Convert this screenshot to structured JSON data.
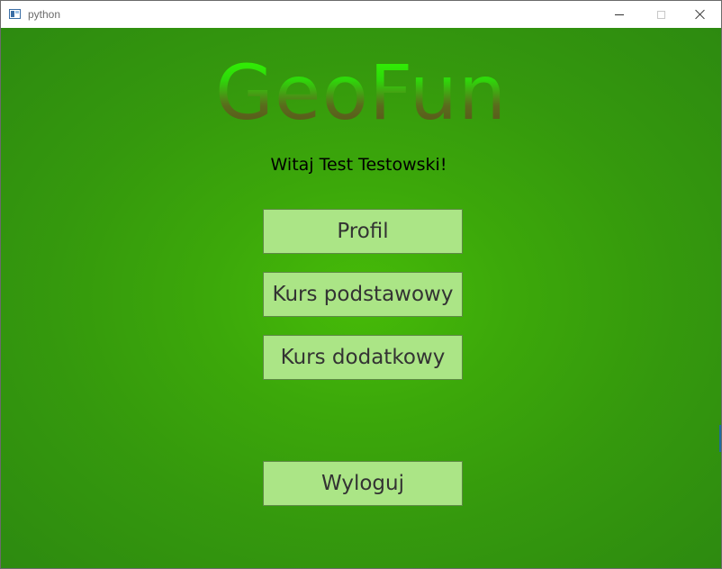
{
  "window": {
    "title": "python",
    "controls": {
      "minimize": "minimize-icon",
      "maximize": "maximize-icon",
      "close": "close-icon"
    }
  },
  "app": {
    "logo": "GeoFun",
    "welcome": "Witaj Test Testowski!",
    "buttons": {
      "profil": "Profil",
      "kurs_podstawowy": "Kurs podstawowy",
      "kurs_dodatkowy": "Kurs dodatkowy",
      "wyloguj": "Wyloguj"
    }
  },
  "colors": {
    "background_center": "#46bb08",
    "background_edge": "#2d8a10",
    "button_fill": "#abe586",
    "button_border": "#5e8a45",
    "logo_top": "#33ff00",
    "logo_bottom": "#5a4e1a"
  }
}
